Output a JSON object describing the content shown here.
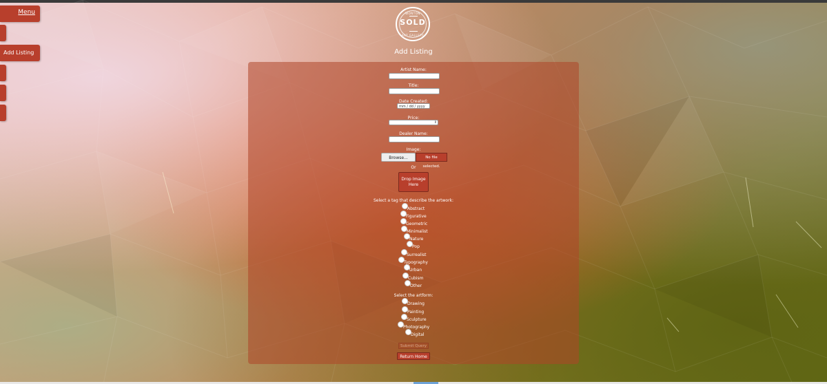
{
  "nav": {
    "menu_label": "Menu",
    "add_listing_label": "Add Listing"
  },
  "logo": {
    "top_text": "WONTON",
    "main_text": "SOLD",
    "bottom_text": "ART GALLERY"
  },
  "page_title": "Add Listing",
  "form": {
    "artist_name_label": "Artist Name:",
    "title_label": "Title:",
    "date_label": "Date Created:",
    "date_placeholder": "mm / dd / yyyy",
    "price_label": "Price:",
    "dealer_label": "Dealer Name:",
    "image_label": "Image:",
    "browse_label": "Browse...",
    "no_file_label": "No file selected.",
    "or_label": "Or",
    "drop_label": "Drop Image Here",
    "tags_prompt": "Select a tag that describe the artwork:",
    "tags": [
      "Abstract",
      "Figurative",
      "Geometric",
      "Minimalist",
      "Nature",
      "Pop",
      "Surrealist",
      "Typography",
      "Urban",
      "Cubism",
      "Other"
    ],
    "artform_prompt": "Select the artform:",
    "artforms": [
      "Drawing",
      "Painting",
      "Sculpture",
      "Photography",
      "Digital"
    ],
    "submit_label": "Submit Query",
    "return_label": "Return Home"
  }
}
